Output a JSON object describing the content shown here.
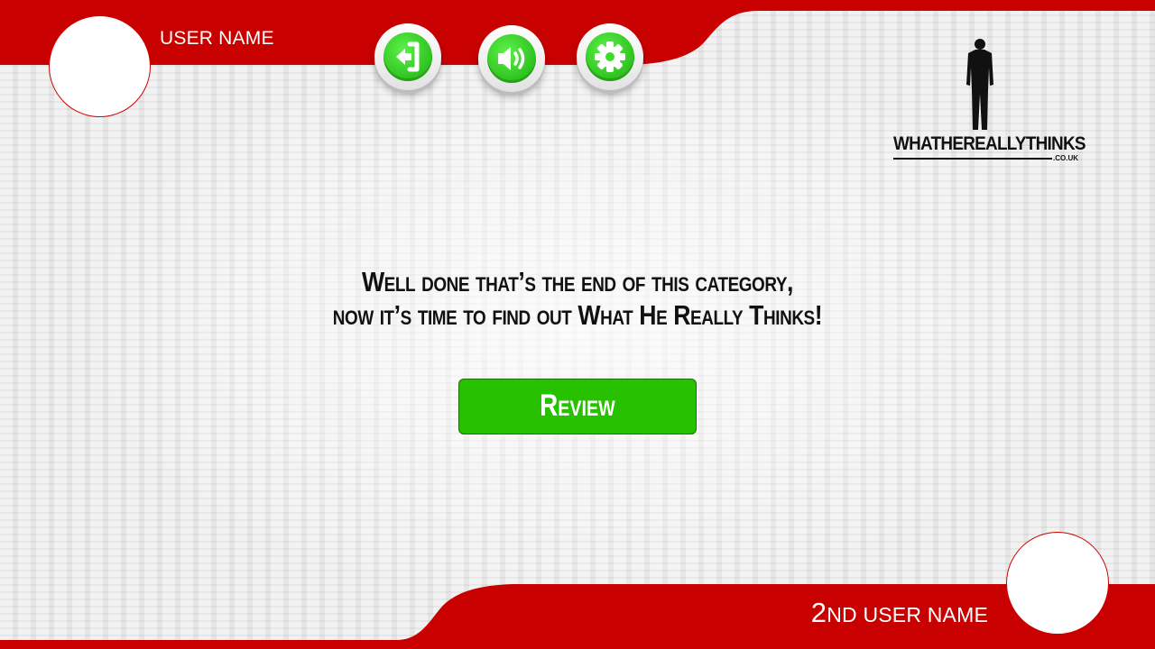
{
  "player_one": {
    "name": "USER NAME"
  },
  "player_two": {
    "name_prefix": "2",
    "name_rest": "ND USER NAME"
  },
  "controls": [
    {
      "name": "exit",
      "icon": "exit-icon"
    },
    {
      "name": "sound",
      "icon": "speaker-icon"
    },
    {
      "name": "settings",
      "icon": "gear-icon"
    }
  ],
  "logo": {
    "text": "WHATHEREALLYTHINKS",
    "sub": ".CO.UK"
  },
  "message": {
    "line1": "Well done that’s the end of this category,",
    "line2": "now it’s time to find out What He Really Thinks!"
  },
  "review_button": {
    "label": "Review"
  },
  "colors": {
    "band": "#c80000",
    "button_green": "#27c100",
    "icon_green": "#3ddc2a"
  }
}
